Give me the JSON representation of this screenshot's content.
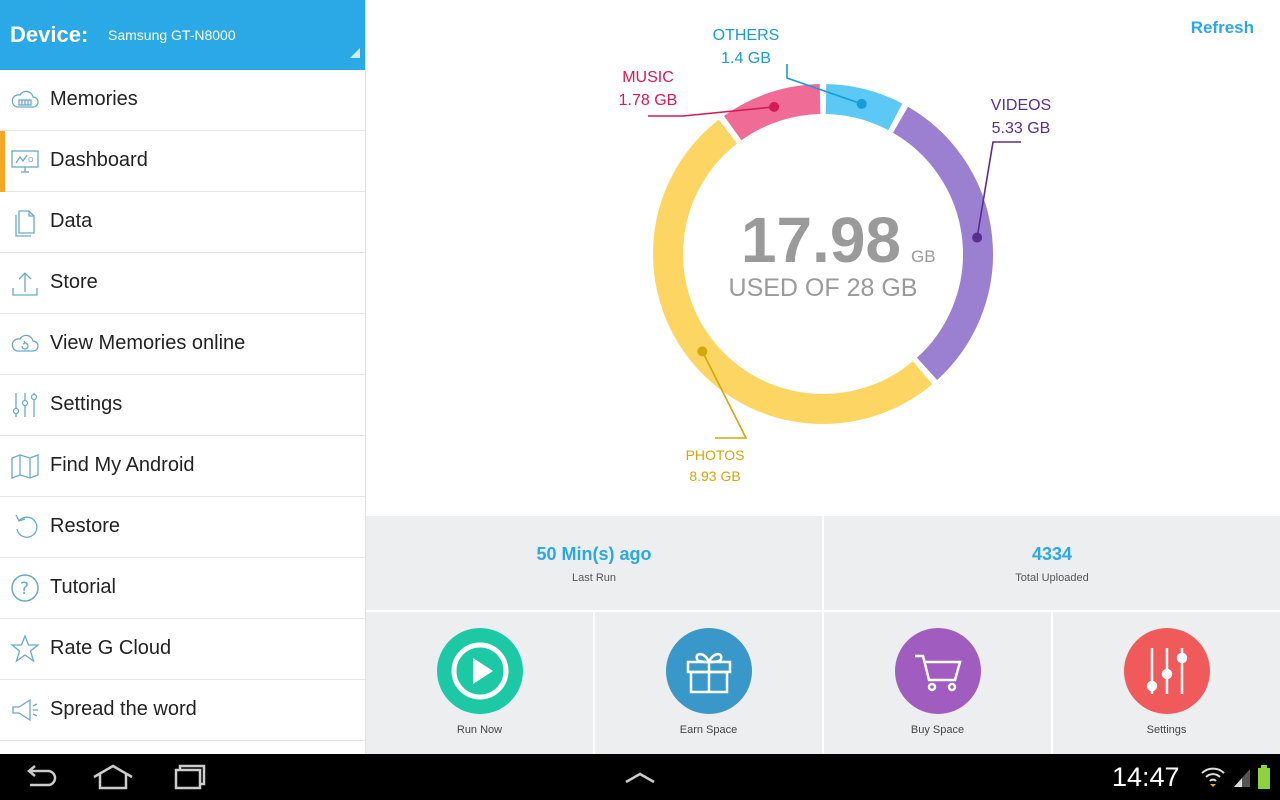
{
  "sidebar": {
    "device_label": "Device:",
    "device_name": "Samsung GT-N8000",
    "items": [
      {
        "label": "Memories",
        "icon": "cloud-film-icon"
      },
      {
        "label": "Dashboard",
        "icon": "presentation-board-icon"
      },
      {
        "label": "Data",
        "icon": "documents-icon"
      },
      {
        "label": "Store",
        "icon": "upload-arrow-icon"
      },
      {
        "label": "View Memories online",
        "icon": "cloud-sync-icon"
      },
      {
        "label": "Settings",
        "icon": "sliders-icon"
      },
      {
        "label": "Find My Android",
        "icon": "map-icon"
      },
      {
        "label": "Restore",
        "icon": "restore-arrow-icon"
      },
      {
        "label": "Tutorial",
        "icon": "question-circle-icon"
      },
      {
        "label": "Rate G Cloud",
        "icon": "star-icon"
      },
      {
        "label": "Spread the word",
        "icon": "megaphone-icon"
      }
    ],
    "active_index": 1,
    "accent_color": "#2ba8e6",
    "active_marker_color": "#f5a623"
  },
  "main": {
    "refresh_label": "Refresh",
    "usage": {
      "used_value": "17.98",
      "used_unit": "GB",
      "used_caption": "USED OF 28 GB"
    },
    "chart_data": {
      "type": "pie",
      "total": 28,
      "used": 17.98,
      "unit": "GB",
      "segments": [
        {
          "name": "OTHERS",
          "value": 1.4,
          "label": "1.4 GB",
          "color": "#5bc8f5"
        },
        {
          "name": "VIDEOS",
          "value": 5.33,
          "label": "5.33 GB",
          "color": "#9b7fd1"
        },
        {
          "name": "PHOTOS",
          "value": 8.93,
          "label": "8.93 GB",
          "color": "#fdd562"
        },
        {
          "name": "MUSIC",
          "value": 1.78,
          "label": "1.78 GB",
          "color": "#f06b96"
        }
      ],
      "label_colors": {
        "OTHERS": "#1b9bd6",
        "VIDEOS": "#5a2d91",
        "PHOTOS": "#d1a70b",
        "MUSIC": "#d61a55"
      }
    },
    "stats": [
      {
        "value": "50 Min(s) ago",
        "caption": "Last Run"
      },
      {
        "value": "4334",
        "caption": "Total Uploaded"
      }
    ],
    "actions": [
      {
        "label": "Run Now",
        "icon": "play-icon",
        "color": "#1dc9a4"
      },
      {
        "label": "Earn Space",
        "icon": "gift-icon",
        "color": "#3a97c9"
      },
      {
        "label": "Buy Space",
        "icon": "cart-icon",
        "color": "#a05dbf"
      },
      {
        "label": "Settings",
        "icon": "sliders-icon",
        "color": "#f05a5a"
      }
    ]
  },
  "system_bar": {
    "time": "14:47",
    "buttons": [
      "back-icon",
      "home-icon",
      "recent-apps-icon",
      "menu-up-icon"
    ],
    "status_icons": [
      "wifi-icon",
      "signal-icon",
      "battery-icon"
    ]
  }
}
